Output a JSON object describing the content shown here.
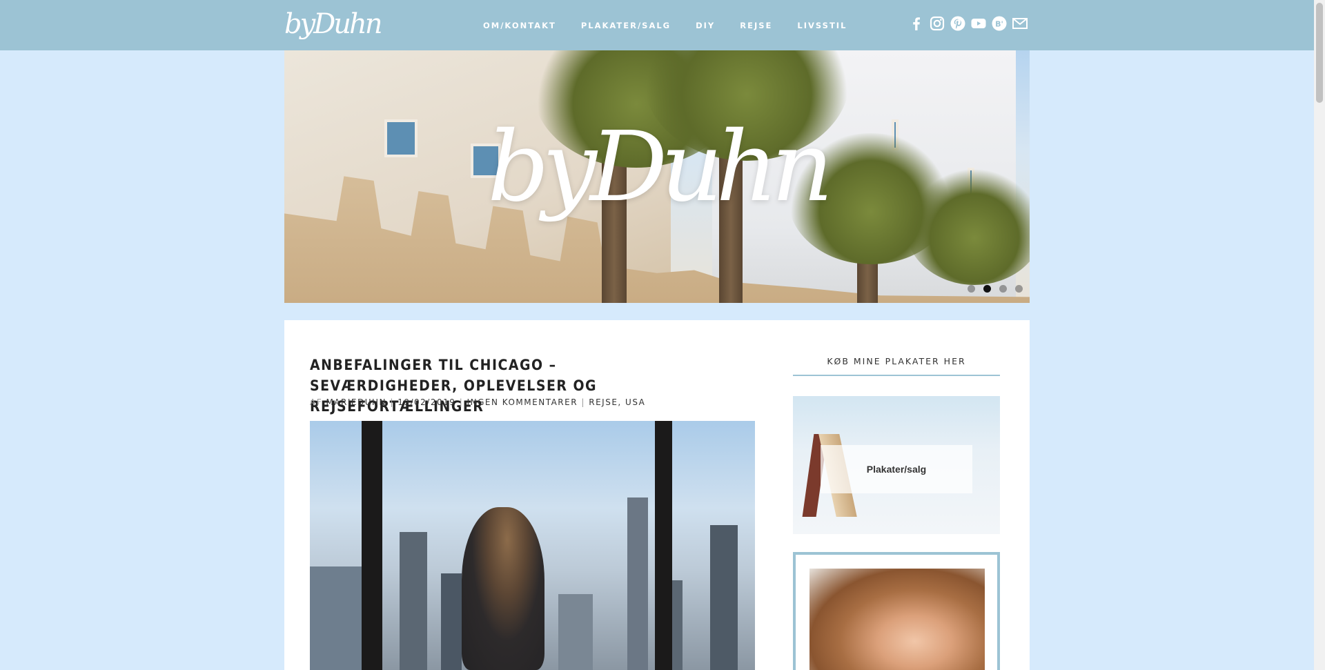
{
  "header": {
    "logo_text": "byDuhn",
    "nav": [
      {
        "label": "OM/KONTAKT"
      },
      {
        "label": "PLAKATER/SALG"
      },
      {
        "label": "DIY"
      },
      {
        "label": "REJSE"
      },
      {
        "label": "LIVSSTIL"
      }
    ],
    "social_icons": [
      "facebook-icon",
      "instagram-icon",
      "pinterest-icon",
      "youtube-icon",
      "bloglovin-icon",
      "mail-icon"
    ]
  },
  "hero": {
    "logo_text": "byDuhn",
    "slider_dots": 4,
    "active_dot": 2
  },
  "post": {
    "title": "ANBEFALINGER TIL CHICAGO – SEVÆRDIGHEDER, OPLEVELSER OG REJSEFORTÆLLINGER",
    "meta": {
      "by_label": "AF",
      "author": "MARIEDUHN",
      "date": "19/02/2019",
      "comments": "INGEN KOMMENTARER",
      "categories": "REJSE, USA",
      "separator": "|"
    }
  },
  "sidebar": {
    "widget_title": "KØB MINE PLAKATER HER",
    "promo_label": "Plakater/salg"
  },
  "colors": {
    "topbar": "#9cc3d4",
    "page_bg": "#d6eafc",
    "card_bg": "#ffffff"
  }
}
